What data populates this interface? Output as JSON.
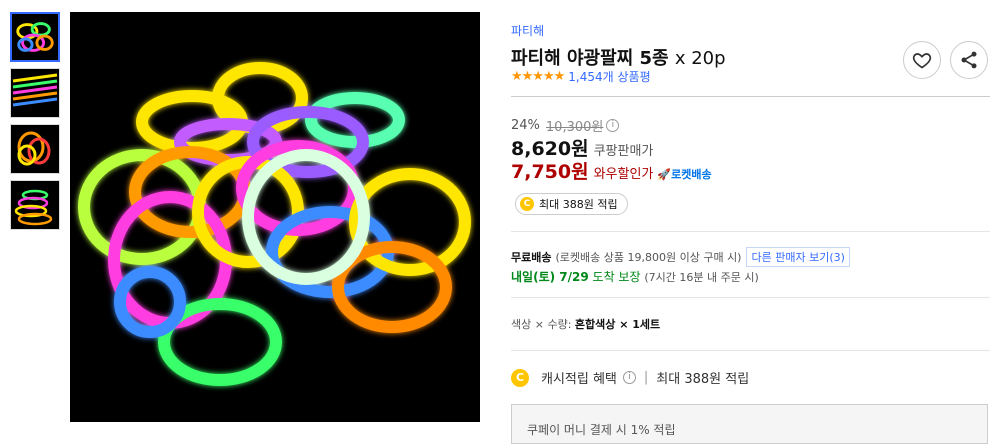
{
  "product": {
    "brand": "파티해",
    "title": "파티해 야광팔찌 5종",
    "title_unit": "x 20p",
    "stars": "★★★★★",
    "review_count": "1,454개 상품평",
    "discount_rate": "24%",
    "original_price": "10,300원",
    "coupang_price": "8,620원",
    "coupang_price_label": "쿠팡판매가",
    "wow_price": "7,750원",
    "wow_price_label": "와우할인가",
    "rocket_label": "🚀로켓배송",
    "cash_badge": "최대 388원 적립",
    "shipping_free": "무료배송",
    "shipping_condition": "(로켓배송 상품 19,800원 이상 구매 시)",
    "other_sellers": "다른 판매자 보기(3)",
    "delivery_day": "내일(토) 7/29",
    "delivery_tail": "도착 보장",
    "delivery_note": "(7시간 16분 내 주문 시)",
    "option_prefix": "색상 × 수량:",
    "option_value": "혼합색상 × 1세트",
    "cash_benefit_label": "캐시적립 혜택",
    "cash_benefit_value": "최대 388원 적립",
    "coupay_text": "쿠페이 머니 결제 시 1% 적립",
    "coin_symbol": "C",
    "info_symbol": "i"
  },
  "icons": {
    "heart": "heart-icon",
    "share": "share-icon"
  },
  "colors": {
    "accent": "#346aff",
    "wow": "#ae0000",
    "star": "#ff9600",
    "delivery": "#00891a",
    "coin": "#ffc600"
  }
}
